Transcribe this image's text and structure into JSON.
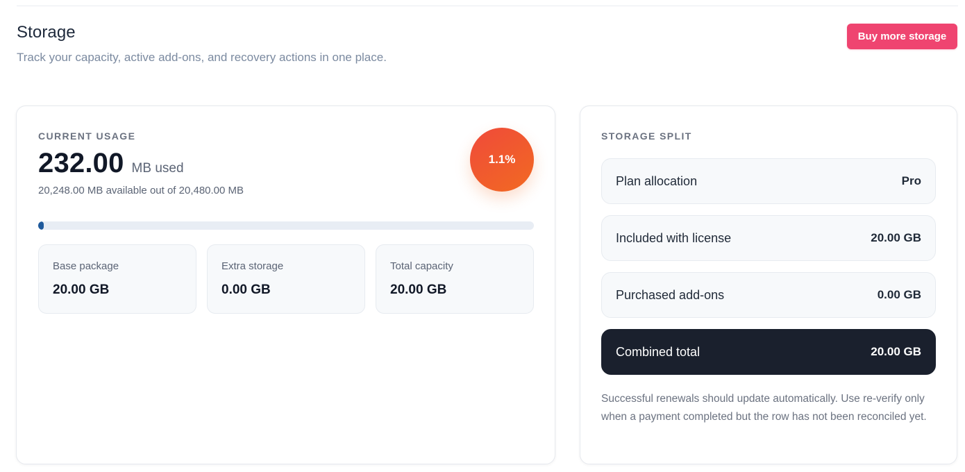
{
  "header": {
    "title": "Storage",
    "subtitle": "Track your capacity, active add-ons, and recovery actions in one place.",
    "buy_button_label": "Buy more storage"
  },
  "usage": {
    "eyebrow": "CURRENT USAGE",
    "value": "232.00",
    "unit": "MB used",
    "available_text": "20,248.00 MB available out of 20,480.00 MB",
    "percent_label": "1.1%",
    "progress_fraction": 0.011,
    "stats": [
      {
        "label": "Base package",
        "value": "20.00 GB"
      },
      {
        "label": "Extra storage",
        "value": "0.00 GB"
      },
      {
        "label": "Total capacity",
        "value": "20.00 GB"
      }
    ]
  },
  "split": {
    "eyebrow": "STORAGE SPLIT",
    "rows": [
      {
        "label": "Plan allocation",
        "value": "Pro"
      },
      {
        "label": "Included with license",
        "value": "20.00 GB"
      },
      {
        "label": "Purchased add-ons",
        "value": "0.00 GB"
      },
      {
        "label": "Combined total",
        "value": "20.00 GB"
      }
    ],
    "note": "Successful renewals should update automatically. Use re-verify only when a payment completed but the row has not been reconciled yet."
  },
  "colors": {
    "accent_button": "#ef4470",
    "badge_gradient_start": "#ef4a3a",
    "badge_gradient_end": "#f26a22",
    "progress_fill": "#1f5a9c",
    "total_row_bg": "#1a202d"
  }
}
